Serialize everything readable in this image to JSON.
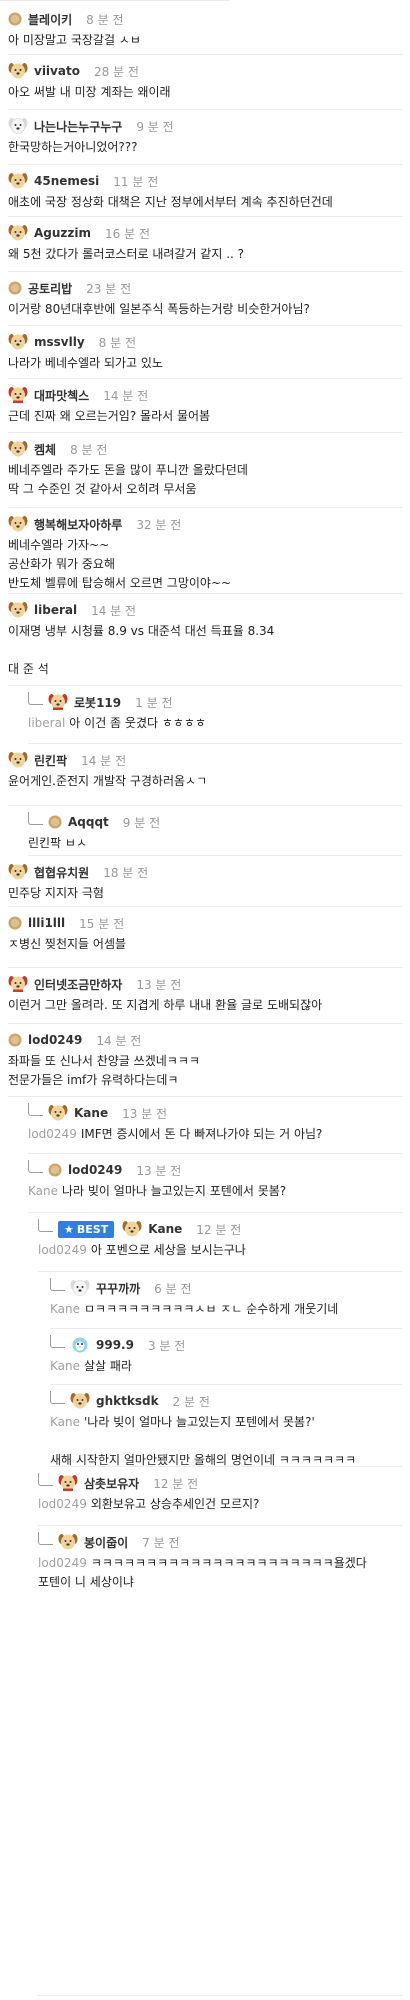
{
  "comments": [
    {
      "nickname": "블레이키",
      "time": "8 분 전",
      "avatar": "round-face-icon",
      "mention": "",
      "body": "아 미장말고 국장갈걸 ㅅㅂ",
      "depth": 0,
      "best": false
    },
    {
      "nickname": "viivato",
      "time": "28 분 전",
      "avatar": "puppy-icon",
      "mention": "",
      "body": "아오 써발 내 미장 계좌는 왜이래",
      "depth": 0,
      "best": false
    },
    {
      "nickname": "나는나는누구누구",
      "time": "9 분 전",
      "avatar": "white-puppy-icon",
      "mention": "",
      "body": "한국망하는거아니었어???",
      "depth": 0,
      "best": false
    },
    {
      "nickname": "45nemesi",
      "time": "11 분 전",
      "avatar": "puppy-icon",
      "mention": "",
      "body": "애초에 국장 정상화 대책은 지난 정부에서부터 계속 추진하던건데",
      "depth": 0,
      "best": false
    },
    {
      "nickname": "Aguzzim",
      "time": "16 분 전",
      "avatar": "puppy-icon",
      "mention": "",
      "body": "왜 5천 갔다가 롤러코스터로 내려갈거 같지 .. ?",
      "depth": 0,
      "best": false
    },
    {
      "nickname": "공토리밥",
      "time": "23 분 전",
      "avatar": "round-face-icon",
      "mention": "",
      "body": "이거랑 80년대후반에 일본주식 폭등하는거랑 비슷한거아님?",
      "depth": 0,
      "best": false
    },
    {
      "nickname": "mssvlly",
      "time": "8 분 전",
      "avatar": "puppy-icon",
      "mention": "",
      "body": "나라가 베네수엘라 되가고 있노",
      "depth": 0,
      "best": false
    },
    {
      "nickname": "대파맛첵스",
      "time": "14 분 전",
      "avatar": "red-puppy-icon",
      "mention": "",
      "body": "근데 진짜 왜 오르는거임? 몰라서 물어봄",
      "depth": 0,
      "best": false
    },
    {
      "nickname": "켐체",
      "time": "8 분 전",
      "avatar": "puppy-icon",
      "mention": "",
      "body": "베네주엘라 주가도 돈을 많이 푸니깐 올랐다던데\n딱 그 수준인 것 같아서 오히려 무서움",
      "depth": 0,
      "best": false
    },
    {
      "nickname": "행복해보자아하루",
      "time": "32 분 전",
      "avatar": "puppy-icon",
      "mention": "",
      "body": "베네수엘라 가자~~\n공산화가 뭐가 중요해\n반도체 벨류에 탑승해서 오르면 그망이야~~",
      "depth": 0,
      "best": false
    },
    {
      "nickname": "liberal",
      "time": "14 분 전",
      "avatar": "puppy-icon",
      "mention": "",
      "body": "이재명 냉부 시청률 8.9 vs 대준석 대선 득표율 8.34\n\n대 준 석",
      "depth": 0,
      "best": false
    },
    {
      "nickname": "로봇119",
      "time": "1 분 전",
      "avatar": "red-puppy-icon",
      "mention": "liberal",
      "body": "아 이건 좀 웃겼다 ㅎㅎㅎㅎ",
      "depth": 1,
      "best": false
    },
    {
      "nickname": "린킨팍",
      "time": "14 분 전",
      "avatar": "puppy-icon",
      "mention": "",
      "body": "윤어게인.준전지 개발작 구경하러옴ㅅㄱ",
      "depth": 0,
      "best": false
    },
    {
      "nickname": "Aqqqt",
      "time": "9 분 전",
      "avatar": "round-face-icon",
      "mention": "",
      "body": "린킨팍 ㅂㅅ",
      "depth": 1,
      "best": false
    },
    {
      "nickname": "협협유치원",
      "time": "18 분 전",
      "avatar": "puppy-icon",
      "mention": "",
      "body": "민주당 지지자 극혐",
      "depth": 0,
      "best": false
    },
    {
      "nickname": "llli1lll",
      "time": "15 분 전",
      "avatar": "round-face-icon",
      "mention": "",
      "body": "ㅈ병신 찢천지들 어셈블",
      "depth": 0,
      "best": false
    },
    {
      "nickname": "인터넷조금만하자",
      "time": "13 분 전",
      "avatar": "red-puppy-icon",
      "mention": "",
      "body": "이런거 그만 올려라. 또 지겹게 하루 내내 환율 글로 도배되잖아",
      "depth": 0,
      "best": false
    },
    {
      "nickname": "lod0249",
      "time": "14 분 전",
      "avatar": "round-face-icon",
      "mention": "",
      "body": "좌파들 또 신나서 찬양글 쓰겠네ㅋㅋㅋ\n전문가들은 imf가 유력하다는데ㅋ",
      "depth": 0,
      "best": false
    },
    {
      "nickname": "Kane",
      "time": "13 분 전",
      "avatar": "puppy-icon",
      "mention": "lod0249",
      "body": "IMF면 증시에서 돈 다 빠져나가야 되는 거 아님?",
      "depth": 1,
      "best": false
    },
    {
      "nickname": "lod0249",
      "time": "13 분 전",
      "avatar": "round-face-icon",
      "mention": "Kane",
      "body": "나라 빚이 얼마나 늘고있는지 포텐에서 못봄?",
      "depth": 2,
      "best": false
    },
    {
      "nickname": "Kane",
      "time": "12 분 전",
      "avatar": "puppy-icon",
      "mention": "lod0249",
      "body": "아 포벤으로 세상을 보시는구나",
      "depth": 3,
      "best": true
    },
    {
      "nickname": "꾸꾸까까",
      "time": "6 분 전",
      "avatar": "white-puppy-icon",
      "mention": "Kane",
      "body": "ㅁㅋㅋㅋㅋㅋㅋㅋㅋㅋㅅㅂ ㅈㄴ 순수하게 개웃기네",
      "depth": 4,
      "best": false
    },
    {
      "nickname": "999.9",
      "time": "3 분 전",
      "avatar": "blue-bird-icon",
      "mention": "Kane",
      "body": "살살 패라",
      "depth": 4,
      "best": false
    },
    {
      "nickname": "ghktksdk",
      "time": "2 분 전",
      "avatar": "puppy-icon",
      "mention": "Kane",
      "body": "'나라 빚이 얼마나 늘고있는지 포텐에서 못봄?'\n\n새해 시작한지 얼마안됐지만 올해의 명언이네 ㅋㅋㅋㅋㅋㅋㅋ",
      "depth": 4,
      "best": false
    },
    {
      "nickname": "삼촛보유자",
      "time": "12 분 전",
      "avatar": "red-puppy-icon",
      "mention": "lod0249",
      "body": "외환보유고 상승추세인건 모르지?",
      "depth": 3,
      "best": false
    },
    {
      "nickname": "봉이줍이",
      "time": "7 분 전",
      "avatar": "puppy-icon",
      "mention": "lod0249",
      "body": "ㅋㅋㅋㅋㅋㅋㅋㅋㅋㅋㅋㅋㅋㅋㅋㅋㅋㅋㅋㅋㅋㅋ욜겠다 포텐이 니 세상이냐",
      "depth": 3,
      "best": false
    }
  ],
  "best_label": "BEST",
  "best_icon": "star-icon",
  "colors": {
    "best_badge": "#2f7fe0",
    "time": "#999999",
    "mention": "#a0a0a0",
    "divider": "#ececec"
  }
}
